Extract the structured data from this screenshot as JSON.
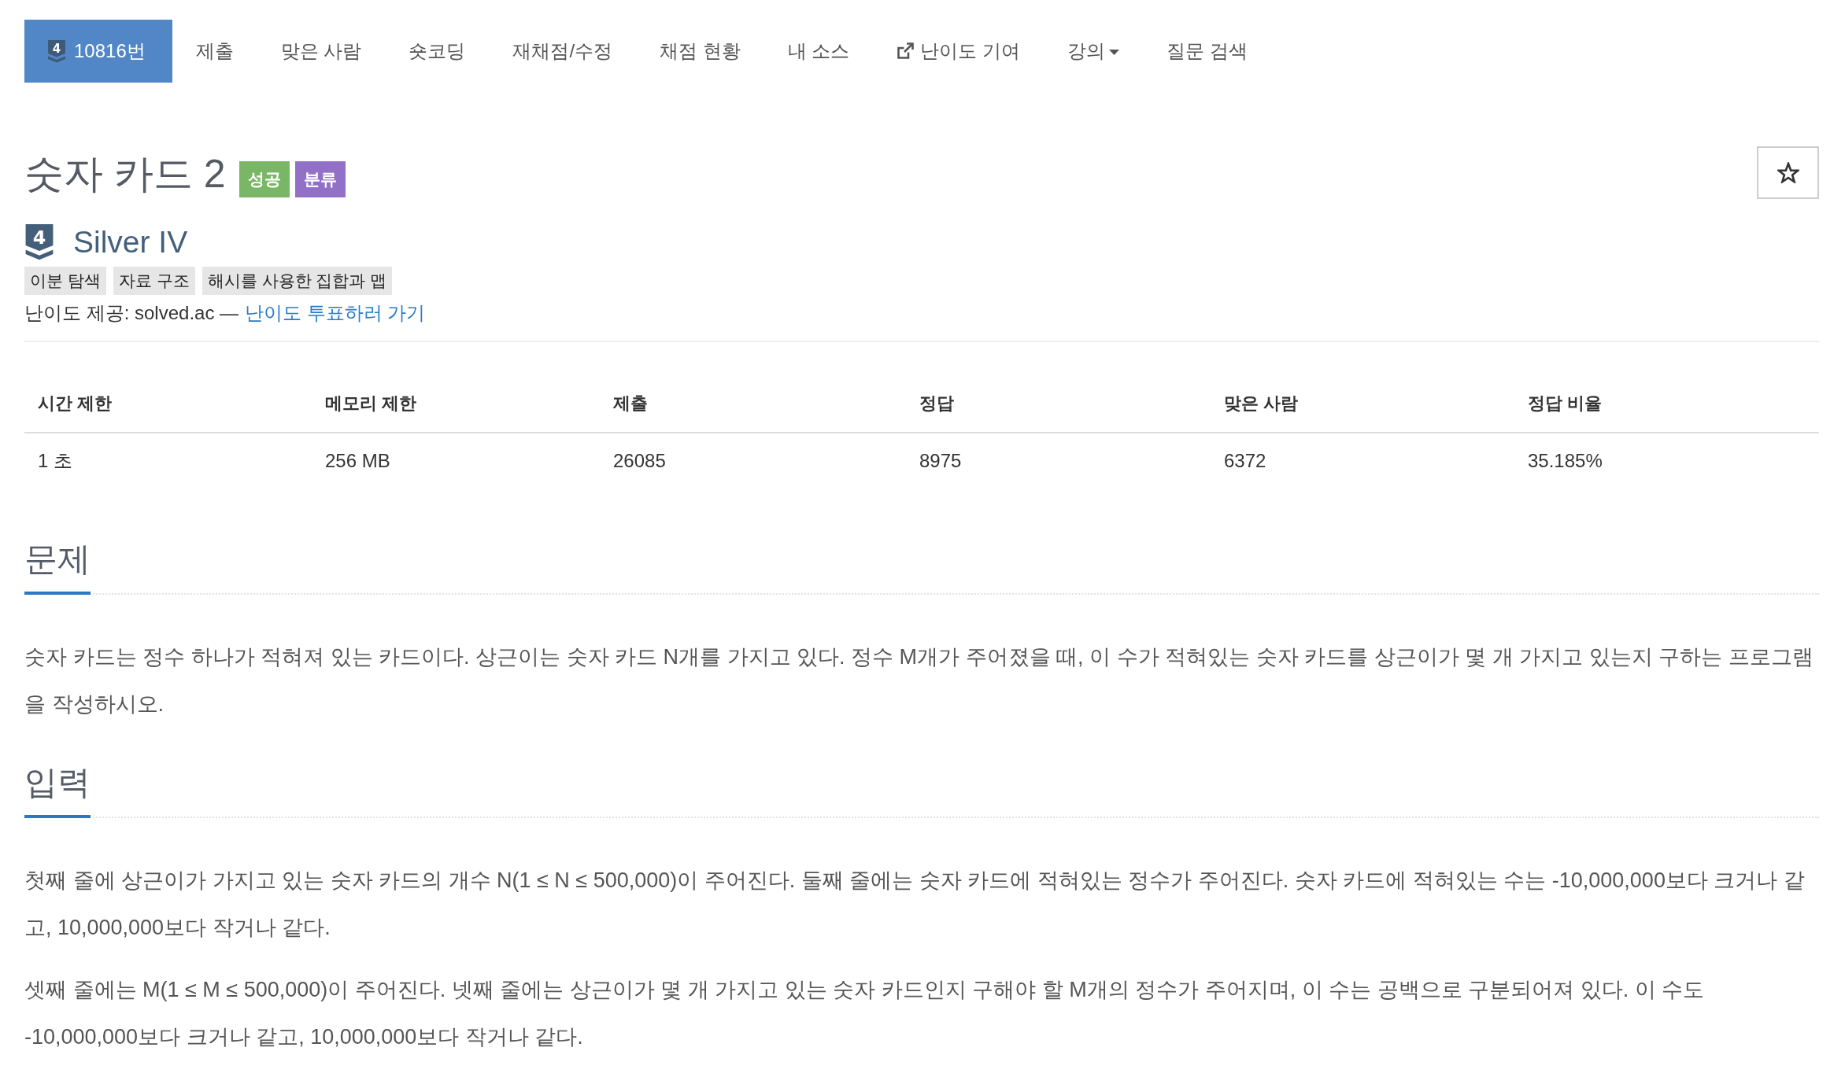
{
  "nav": [
    {
      "kind": "problem",
      "icon_number": "4",
      "label": "10816번",
      "selected": true
    },
    {
      "kind": "link",
      "label": "제출",
      "selected": false
    },
    {
      "kind": "link",
      "label": "맞은 사람",
      "selected": false
    },
    {
      "kind": "link",
      "label": "숏코딩",
      "selected": false
    },
    {
      "kind": "link",
      "label": "재채점/수정",
      "selected": false
    },
    {
      "kind": "link",
      "label": "채점 현황",
      "selected": false
    },
    {
      "kind": "link",
      "label": "내 소스",
      "selected": false
    },
    {
      "kind": "external",
      "label": "난이도 기여",
      "selected": false
    },
    {
      "kind": "dropdown",
      "label": "강의",
      "selected": false
    },
    {
      "kind": "link",
      "label": "질문 검색",
      "selected": false
    }
  ],
  "problem": {
    "title": "숫자 카드 2",
    "badges": [
      {
        "label": "성공",
        "color": "#79b665"
      },
      {
        "label": "분류",
        "color": "#9370c8"
      }
    ],
    "tier": {
      "icon_number": "4",
      "label": "Silver IV"
    },
    "tags": [
      "이분 탐색",
      "자료 구조",
      "해시를 사용한 집합과 맵"
    ],
    "credit": {
      "text": "난이도 제공: solved.ac —",
      "link": "난이도 투표하러 가기"
    }
  },
  "stats_table": {
    "columns": [
      "시간 제한",
      "메모리 제한",
      "제출",
      "정답",
      "맞은 사람",
      "정답 비율"
    ],
    "rows": [
      [
        "1 초",
        "256 MB",
        "26085",
        "8975",
        "6372",
        "35.185%"
      ]
    ]
  },
  "sections": [
    {
      "heading": "문제",
      "paragraphs": [
        "숫자 카드는 정수 하나가 적혀져 있는 카드이다. 상근이는 숫자 카드 N개를 가지고 있다. 정수 M개가 주어졌을 때, 이 수가 적혀있는 숫자 카드를 상근이가 몇 개 가지고 있는지 구하는 프로그램을 작성하시오."
      ]
    },
    {
      "heading": "입력",
      "paragraphs": [
        "첫째 줄에 상근이가 가지고 있는 숫자 카드의 개수 N(1 ≤ N ≤ 500,000)이 주어진다. 둘째 줄에는 숫자 카드에 적혀있는 정수가 주어진다. 숫자 카드에 적혀있는 수는 -10,000,000보다 크거나 같고, 10,000,000보다 작거나 같다.",
        "셋째 줄에는 M(1 ≤ M ≤ 500,000)이 주어진다. 넷째 줄에는 상근이가 몇 개 가지고 있는 숫자 카드인지 구해야 할 M개의 정수가 주어지며, 이 수는 공백으로 구분되어져 있다. 이 수도 -10,000,000보다 크거나 같고, 10,000,000보다 작거나 같다."
      ]
    }
  ]
}
